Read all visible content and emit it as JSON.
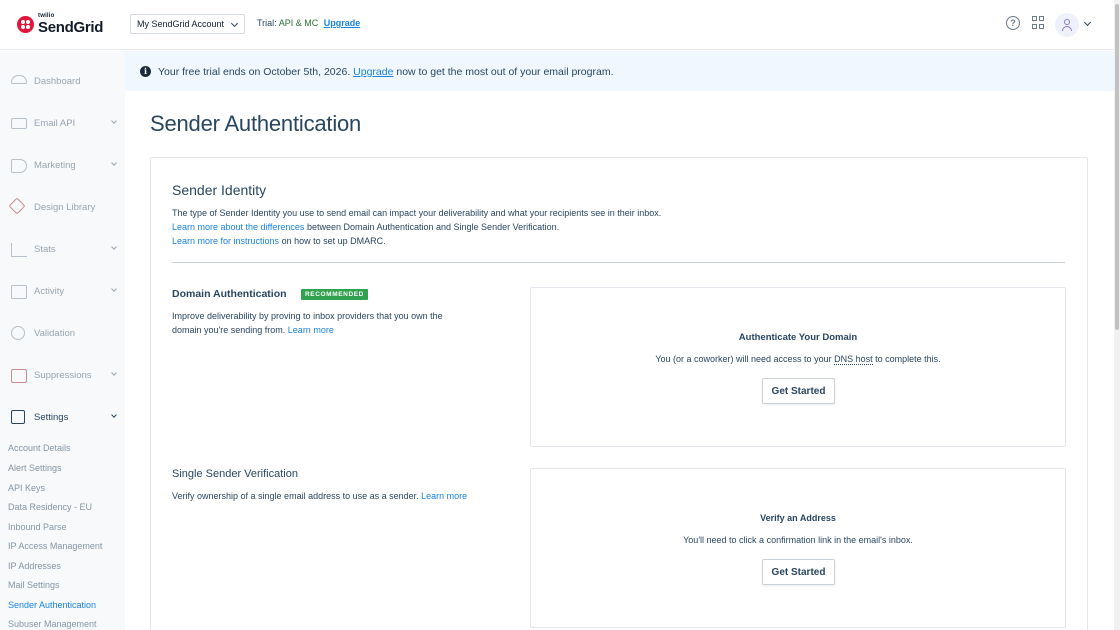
{
  "header": {
    "logo_small": "twilio",
    "logo_main": "SendGrid",
    "account_select": "My SendGrid Account",
    "trial_label": "Trial:",
    "trial_plan": "API & MC",
    "trial_upgrade": "Upgrade",
    "help_icon": "question-circle-icon",
    "apps_icon": "grid-icon",
    "user_icon": "user-icon"
  },
  "banner": {
    "text_before": "Your free trial ends on October 5th, 2026.",
    "link": "Upgrade",
    "text_after": "now to get the most out of your email program."
  },
  "sidebar": {
    "items": [
      {
        "label": "Dashboard",
        "icon": "dashboard-icon"
      },
      {
        "label": "Email API",
        "icon": "email-api-icon"
      },
      {
        "label": "Marketing",
        "icon": "megaphone-icon"
      },
      {
        "label": "Design Library",
        "icon": "design-library-icon"
      },
      {
        "label": "Stats",
        "icon": "stats-icon"
      },
      {
        "label": "Activity",
        "icon": "activity-icon"
      },
      {
        "label": "Validation",
        "icon": "validation-icon"
      },
      {
        "label": "Suppressions",
        "icon": "suppressions-icon"
      },
      {
        "label": "Settings",
        "icon": "settings-icon"
      }
    ],
    "settings_sub": [
      "Account Details",
      "Alert Settings",
      "API Keys",
      "Data Residency - EU",
      "Inbound Parse",
      "IP Access Management",
      "IP Addresses",
      "Mail Settings",
      "Sender Authentication",
      "Subuser Management"
    ]
  },
  "main": {
    "page_title": "Sender Authentication",
    "identity": {
      "title": "Sender Identity",
      "line1": "The type of Sender Identity you use to send email can impact your deliverability and what your recipients see in their inbox.",
      "line2_link": "Learn more about the differences",
      "line2_text": "between Domain Authentication and Single Sender Verification.",
      "line3_link": "Learn more for instructions",
      "line3_text": "on how to set up DMARC."
    },
    "domain": {
      "title": "Domain Authentication",
      "badge": "RECOMMENDED",
      "desc": "Improve deliverability by proving to inbox providers that you own the domain you're sending from.",
      "link": "Learn more",
      "panel_title": "Authenticate Your Domain",
      "panel_desc_before": "You (or a coworker) will need access to your",
      "panel_desc_dns": "DNS host",
      "panel_desc_after": "to complete this.",
      "button": "Get Started"
    },
    "single": {
      "title": "Single Sender Verification",
      "desc": "Verify ownership of a single email address to use as a sender.",
      "link": "Learn more",
      "panel_title": "Verify an Address",
      "panel_desc": "You'll need to click a confirmation link in the email's inbox.",
      "button": "Get Started"
    }
  }
}
